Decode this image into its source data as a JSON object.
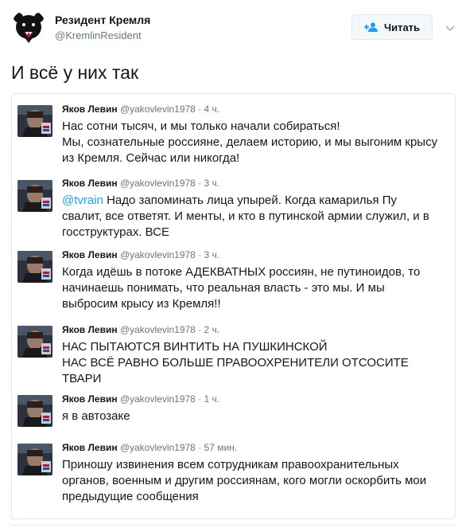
{
  "author": {
    "name": "Резидент Кремля",
    "handle": "@KremlinResident"
  },
  "follow_button": {
    "label": "Читать"
  },
  "tweet": {
    "text": "И всё у них так"
  },
  "colors": {
    "link": "#1da1f2",
    "meta": "#657786",
    "border": "#e1e8ed"
  },
  "quoted_tweets": [
    {
      "name": "Яков Левин",
      "handle": "@yakovlevin1978",
      "time": "4 ч.",
      "lines": [
        "Нас сотни тысяч, и мы только начали собираться!",
        "Мы, сознательные россияне, делаем историю, и мы выгоним крысу",
        "из Кремля. Сейчас или никогда!"
      ]
    },
    {
      "name": "Яков Левин",
      "handle": "@yakovlevin1978",
      "time": "3 ч.",
      "mention": "@tvrain",
      "lines": [
        " Надо запоминать лица упырей. Когда камарилья Пу",
        "свалит, все ответят. И менты, и кто в путинской армии служил, и в",
        "госструктурах. ВСЕ"
      ]
    },
    {
      "name": "Яков Левин",
      "handle": "@yakovlevin1978",
      "time": "3 ч.",
      "lines": [
        "Когда идёшь в потоке АДЕКВАТНЫХ россиян, не путиноидов, то",
        "начинаешь понимать, что реальная власть - это мы. И мы",
        "выбросим крысу из Кремля!!"
      ]
    },
    {
      "name": "Яков Левин",
      "handle": "@yakovlevin1978",
      "time": "2 ч.",
      "lines": [
        "НАС ПЫТАЮТСЯ ВИНТИТЬ НА ПУШКИНСКОЙ",
        "НАС ВСЁ РАВНО БОЛЬШЕ ПРАВООХРЕНИТЕЛИ ОТСОСИТЕ",
        "ТВАРИ"
      ]
    },
    {
      "name": "Яков Левин",
      "handle": "@yakovlevin1978",
      "time": "1 ч.",
      "lines": [
        "я в автозаке"
      ]
    },
    {
      "name": "Яков Левин",
      "handle": "@yakovlevin1978",
      "time": "57 мин.",
      "lines": [
        "Приношу извинения всем сотрудникам правоохранительных",
        "органов, военным и другим россиянам, кого могли оскорбить мои",
        "предыдущие сообщения"
      ]
    }
  ]
}
